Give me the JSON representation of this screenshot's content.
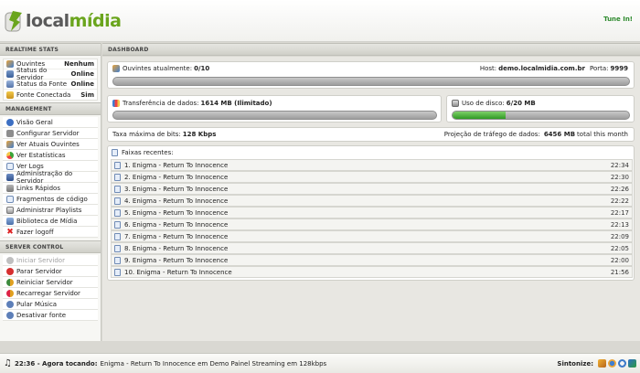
{
  "header": {
    "logo_local": "local",
    "logo_midia": "mídia",
    "tune_in": "Tune In!"
  },
  "colors": {
    "brand_green": "#6aa51d",
    "logo_gray": "#5a5a5a",
    "progress_green": "#2f9a24"
  },
  "sidebar": {
    "realtime_title": "REALTIME STATS",
    "stats": [
      {
        "label": "Ouvintes",
        "value": "Nenhum",
        "icon": "users-icon"
      },
      {
        "label": "Status do Servidor",
        "value": "Online",
        "icon": "server-icon"
      },
      {
        "label": "Status da Fonte",
        "value": "Online",
        "icon": "source-icon"
      },
      {
        "label": "Fonte Conectada",
        "value": "Sim",
        "icon": "plug-icon"
      }
    ],
    "management_title": "MANAGEMENT",
    "management": [
      {
        "label": "Visão Geral",
        "icon": "info-icon"
      },
      {
        "label": "Configurar Servidor",
        "icon": "wrench-icon"
      },
      {
        "label": "Ver Atuais Ouvintes",
        "icon": "users-icon"
      },
      {
        "label": "Ver Estatísticas",
        "icon": "stats-icon"
      },
      {
        "label": "Ver Logs",
        "icon": "document-icon"
      },
      {
        "label": "Administração do Servidor",
        "icon": "admin-icon"
      },
      {
        "label": "Links Rápidos",
        "icon": "link-icon"
      },
      {
        "label": "Fragmentos de código",
        "icon": "code-icon"
      },
      {
        "label": "Administrar Playlists",
        "icon": "playlist-icon"
      },
      {
        "label": "Biblioteca de Mídia",
        "icon": "media-library-icon"
      },
      {
        "label": "Fazer logoff",
        "icon": "close-icon"
      }
    ],
    "server_control_title": "SERVER CONTROL",
    "server_control": [
      {
        "label": "Iniciar Servidor",
        "icon": "play-icon",
        "disabled": true
      },
      {
        "label": "Parar Servidor",
        "icon": "stop-icon",
        "disabled": false
      },
      {
        "label": "Reiniciar Servidor",
        "icon": "restart-icon",
        "disabled": false
      },
      {
        "label": "Recarregar Servidor",
        "icon": "reload-icon",
        "disabled": false
      },
      {
        "label": "Pular Música",
        "icon": "skip-icon",
        "disabled": false
      },
      {
        "label": "Desativar fonte",
        "icon": "deactivate-icon",
        "disabled": false
      }
    ]
  },
  "dashboard": {
    "title": "DASHBOARD",
    "listeners_label": "Ouvintes atualmente:",
    "listeners_value": "0/10",
    "listeners_fraction": 0,
    "host_label": "Host:",
    "host_value": "demo.localmidia.com.br",
    "port_label": "Porta:",
    "port_value": "9999",
    "transfer_label": "Transferência de dados:",
    "transfer_value": "1614 MB (Ilimitado)",
    "transfer_fraction": 0,
    "disk_label": "Uso de disco:",
    "disk_value": "6/20 MB",
    "disk_fraction": 0.3,
    "bitrate_label": "Taxa máxima de bits:",
    "bitrate_value": "128 Kbps",
    "projection_label": "Projeção de tráfego de dados:",
    "projection_value": "6456 MB",
    "projection_suffix": "total this month",
    "recent_title": "Faixas recentes:",
    "tracks": [
      {
        "name": "1. Enigma - Return To Innocence",
        "time": "22:34"
      },
      {
        "name": "2. Enigma - Return To Innocence",
        "time": "22:30"
      },
      {
        "name": "3. Enigma - Return To Innocence",
        "time": "22:26"
      },
      {
        "name": "4. Enigma - Return To Innocence",
        "time": "22:22"
      },
      {
        "name": "5. Enigma - Return To Innocence",
        "time": "22:17"
      },
      {
        "name": "6. Enigma - Return To Innocence",
        "time": "22:13"
      },
      {
        "name": "7. Enigma - Return To Innocence",
        "time": "22:09"
      },
      {
        "name": "8. Enigma - Return To Innocence",
        "time": "22:05"
      },
      {
        "name": "9. Enigma - Return To Innocence",
        "time": "22:00"
      },
      {
        "name": "10. Enigma - Return To Innocence",
        "time": "21:56"
      }
    ]
  },
  "footer": {
    "now_time": "22:36 - Agora tocando:",
    "now_text": "Enigma - Return To Innocence em Demo Painel Streaming em 128kbps",
    "tune_label": "Sintonize:",
    "players": [
      "winamp-icon",
      "realplayer-icon",
      "quicktime-icon",
      "windows-media-icon"
    ]
  }
}
